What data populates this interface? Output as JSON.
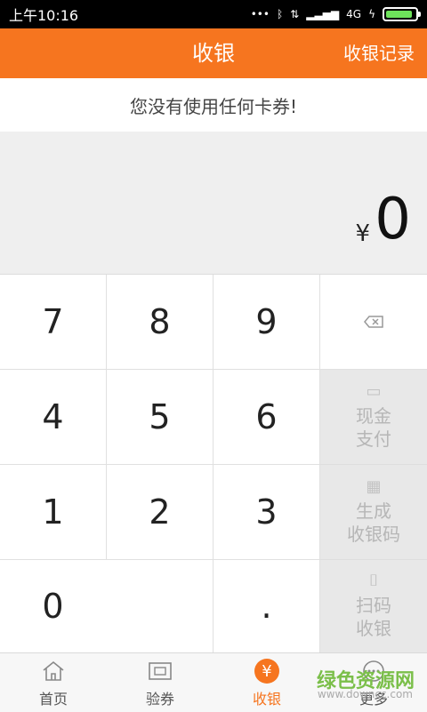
{
  "status_bar": {
    "time": "上午10:16",
    "signal_text": "4G",
    "battery_level": 0.9,
    "colors": {
      "battery": "#6ee35b"
    }
  },
  "header": {
    "title": "收银",
    "history_label": "收银记录",
    "accent_color": "#f6751f"
  },
  "coupon_notice": "您没有使用任何卡券!",
  "amount": {
    "currency": "¥",
    "value": "0"
  },
  "keypad": {
    "keys": [
      "7",
      "8",
      "9",
      "4",
      "5",
      "6",
      "1",
      "2",
      "3",
      "0",
      "."
    ],
    "actions": {
      "backspace_icon": "backspace-icon",
      "cash_pay": {
        "line1": "现金",
        "line2": "支付",
        "icon": "cash-icon"
      },
      "generate_code": {
        "line1": "生成",
        "line2": "收银码",
        "icon": "qr-icon"
      },
      "scan_pay": {
        "line1": "扫码",
        "line2": "收银",
        "icon": "scan-icon"
      }
    }
  },
  "bottom_nav": {
    "items": [
      {
        "label": "首页",
        "icon": "home-icon"
      },
      {
        "label": "验券",
        "icon": "verify-icon"
      },
      {
        "label": "收银",
        "icon": "cashier-icon"
      },
      {
        "label": "更多",
        "icon": "more-icon"
      }
    ],
    "active_index": 2
  },
  "watermark": {
    "text": "绿色资源网",
    "sub": "www.downcc.com"
  }
}
